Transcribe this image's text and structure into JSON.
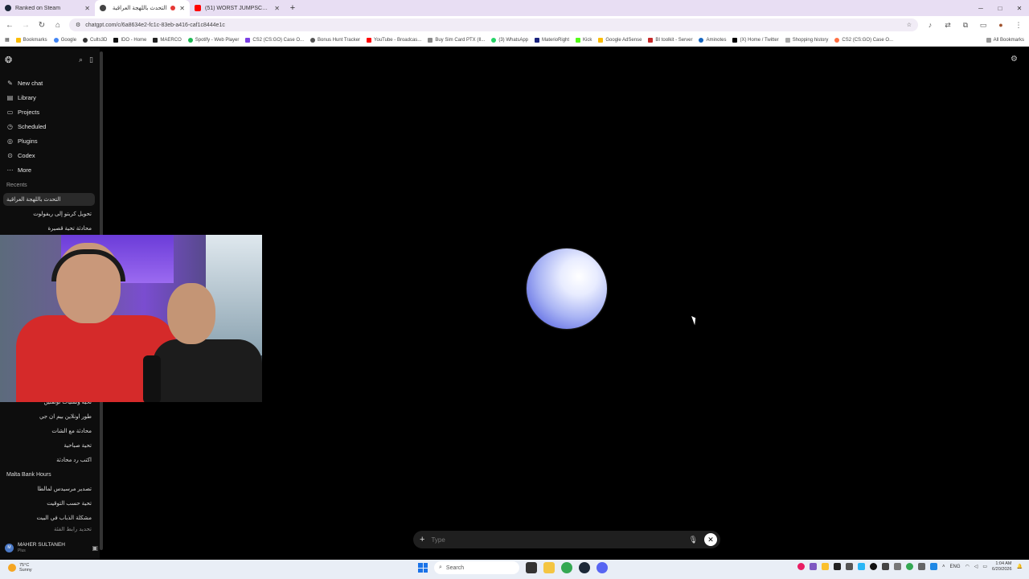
{
  "browser": {
    "tabs": [
      {
        "title": "Ranked on Steam",
        "favicon_color": "#1b2838"
      },
      {
        "title": "التحدث باللهجة العراقية",
        "favicon_color": "#444444"
      },
      {
        "title": "(51) WORST JUMPSCARE OF A",
        "favicon_color": "#ff0000"
      }
    ],
    "url": "chatgpt.com/c/6a8634e2-fc1c-83eb-a416-caf1c8444e1c",
    "bookmarks": [
      "Bookmarks",
      "Google",
      "Cults3D",
      "IDO - Home",
      "MAERCO",
      "Spotify - Web Player",
      "CS2 (CS:GO) Case O...",
      "Bonus Hunt Tracker",
      "YouTube - Broadcas...",
      "Buy Sim Card PTX (Il...",
      "(3) WhatsApp",
      "MaterioRight",
      "Kick",
      "Google AdSense",
      "BI toolkit - Server",
      "Aminotes",
      "(X) Home / Twitter",
      "Shopping history",
      "CS2 (CS:GO) Case O..."
    ],
    "all_bookmarks": "All Bookmarks"
  },
  "sidebar": {
    "nav": [
      {
        "label": "New chat",
        "icon": "✎"
      },
      {
        "label": "Library",
        "icon": "▤"
      },
      {
        "label": "Projects",
        "icon": "▭"
      },
      {
        "label": "Scheduled",
        "icon": "◷"
      },
      {
        "label": "Plugins",
        "icon": "◎"
      },
      {
        "label": "Codex",
        "icon": "⊙"
      },
      {
        "label": "More",
        "icon": "⋯"
      }
    ],
    "recents_label": "Recents",
    "recents_top": [
      "التحدث باللهجة العراقية",
      "تحويل كربتو إلى ريفولوت",
      "محادثة تحية قصيرة"
    ],
    "recents_bottom": [
      "تحية وتمنيات لونقلين",
      "طور اونلاين بيم ان جي",
      "محادثة مع الشات",
      "تحية صباحية",
      "اكتب رد محادثة",
      "Malta Bank Hours",
      "تصدير مرسيدس لمالطا",
      "تحية حسب التوقيت",
      "مشكلة الذباب في البيت",
      "تحديد رابط الفئة"
    ],
    "user": {
      "name": "MAHER SULTANEH",
      "plan": "Plus",
      "initials": "M"
    }
  },
  "composer": {
    "placeholder": "Type"
  },
  "taskbar": {
    "weather_temp": "75°C",
    "weather_desc": "Sunny",
    "search": "Search",
    "lang": "ENG",
    "time": "1:04 AM",
    "date": "6/20/2026"
  }
}
